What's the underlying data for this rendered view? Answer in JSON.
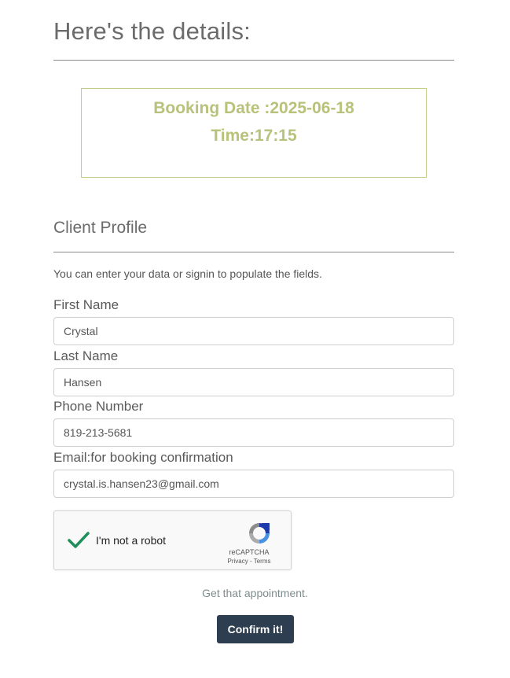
{
  "header": {
    "title": "Here's the details:"
  },
  "booking": {
    "date_line": "Booking Date :2025-06-18",
    "time_line": "Time:17:15"
  },
  "profile": {
    "section_title": "Client Profile",
    "helper": "You can enter your data or signin to populate the fields.",
    "fields": [
      {
        "label": "First Name",
        "value": "Crystal"
      },
      {
        "label": "Last Name",
        "value": "Hansen"
      },
      {
        "label": "Phone Number",
        "value": "819-213-5681"
      },
      {
        "label": "Email:for booking confirmation",
        "value": "crystal.is.hansen23@gmail.com"
      }
    ]
  },
  "captcha": {
    "label": "I'm not a robot",
    "checked": true,
    "brand": "reCAPTCHA",
    "links": "Privacy - Terms",
    "check_icon": "checkmark-icon",
    "logo_icon": "recaptcha-logo-icon"
  },
  "actions": {
    "cta_text": "Get that appointment.",
    "confirm_label": "Confirm it!"
  },
  "colors": {
    "booking_accent": "#b9c27a",
    "button_bg": "#2c3e50",
    "check_green": "#1e8e5a"
  }
}
